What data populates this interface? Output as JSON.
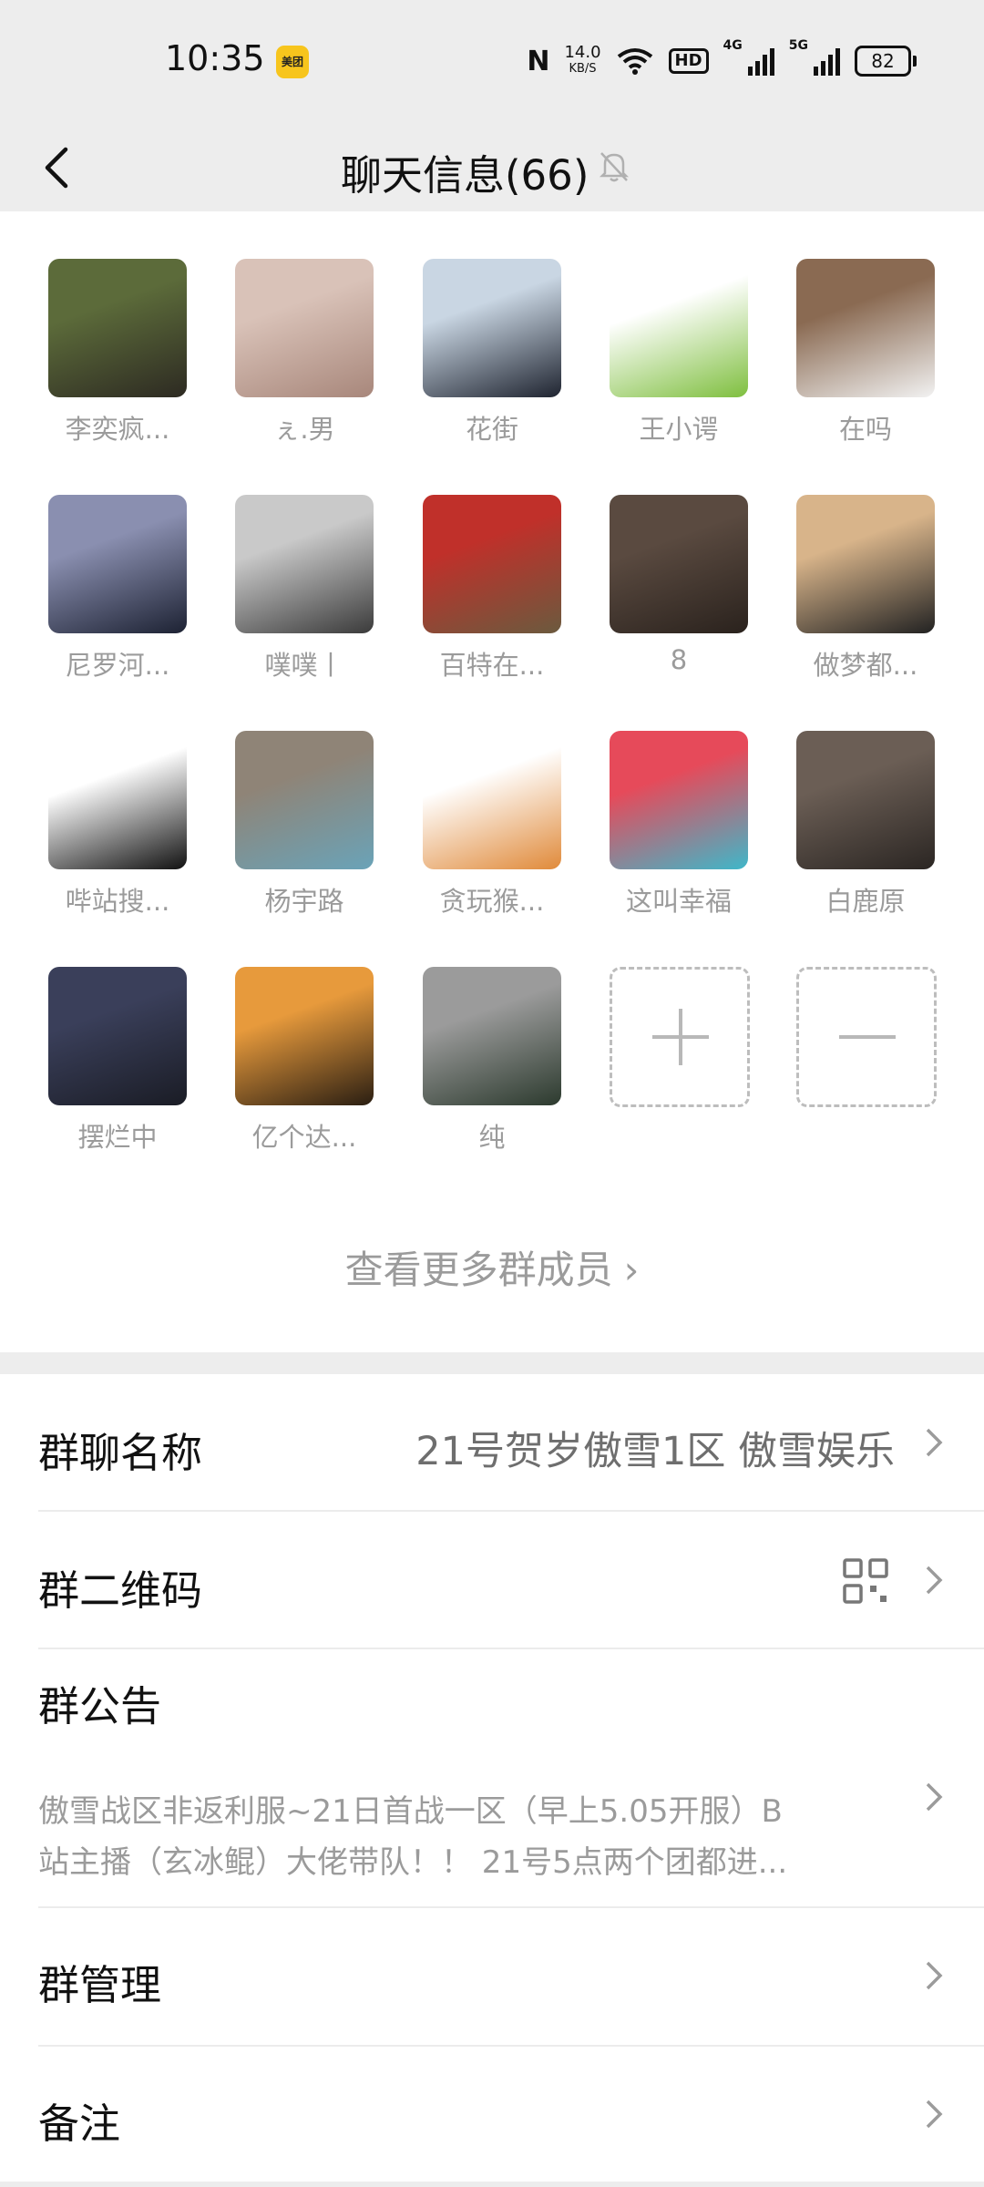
{
  "status_bar": {
    "time": "10:35",
    "app_badge": "美团",
    "nfc": "N",
    "speed_value": "14.0",
    "speed_unit": "KB/S",
    "hd": "HD",
    "net1": "4G",
    "net2": "5G",
    "battery": "82"
  },
  "header": {
    "title": "聊天信息(66)"
  },
  "members": [
    {
      "name": "李奕疯...",
      "color1": "#5c6b3a",
      "color2": "#2d2a22"
    },
    {
      "name": "ぇ.男",
      "color1": "#d9c2b8",
      "color2": "#a8877b"
    },
    {
      "name": "花街",
      "color1": "#c9d6e3",
      "color2": "#1f2430"
    },
    {
      "name": "王小谔",
      "color1": "#ffffff",
      "color2": "#7fbf3f"
    },
    {
      "name": "在吗",
      "color1": "#8a6a52",
      "color2": "#f2f2f2"
    },
    {
      "name": "尼罗河...",
      "color1": "#8a8fb0",
      "color2": "#1d2233"
    },
    {
      "name": "噗噗丨",
      "color1": "#c9c9c9",
      "color2": "#3b3b3b"
    },
    {
      "name": "百特在...",
      "color1": "#c0302a",
      "color2": "#6b5a3e"
    },
    {
      "name": "8",
      "color1": "#5a4a40",
      "color2": "#2a221d"
    },
    {
      "name": "做梦都...",
      "color1": "#d8b48a",
      "color2": "#222222"
    },
    {
      "name": "哔站搜...",
      "color1": "#ffffff",
      "color2": "#111111"
    },
    {
      "name": "杨宇路",
      "color1": "#8f8477",
      "color2": "#6aa3b8"
    },
    {
      "name": "贪玩猴...",
      "color1": "#ffffff",
      "color2": "#e08a3a"
    },
    {
      "name": "这叫幸福",
      "color1": "#e64a5a",
      "color2": "#3fb7c9"
    },
    {
      "name": "白鹿原",
      "color1": "#6b5e55",
      "color2": "#2b2623"
    },
    {
      "name": "摆烂中",
      "color1": "#3a3f5a",
      "color2": "#1a1c25"
    },
    {
      "name": "亿个达...",
      "color1": "#e79a3c",
      "color2": "#2a1e12"
    },
    {
      "name": "纯",
      "color1": "#9b9b9b",
      "color2": "#2c3a2e"
    }
  ],
  "more_members": "查看更多群成员",
  "settings": {
    "group_name_label": "群聊名称",
    "group_name_value": "21号贺岁傲雪1区 傲雪娱乐",
    "qr_label": "群二维码",
    "notice_label": "群公告",
    "notice_line1": "傲雪战区非返利服~21日首战一区（早上5.05开服）B",
    "notice_line2": "站主播（玄冰鲲）大佬带队！！ 21号5点两个团都进...",
    "manage_label": "群管理",
    "remark_label": "备注"
  }
}
